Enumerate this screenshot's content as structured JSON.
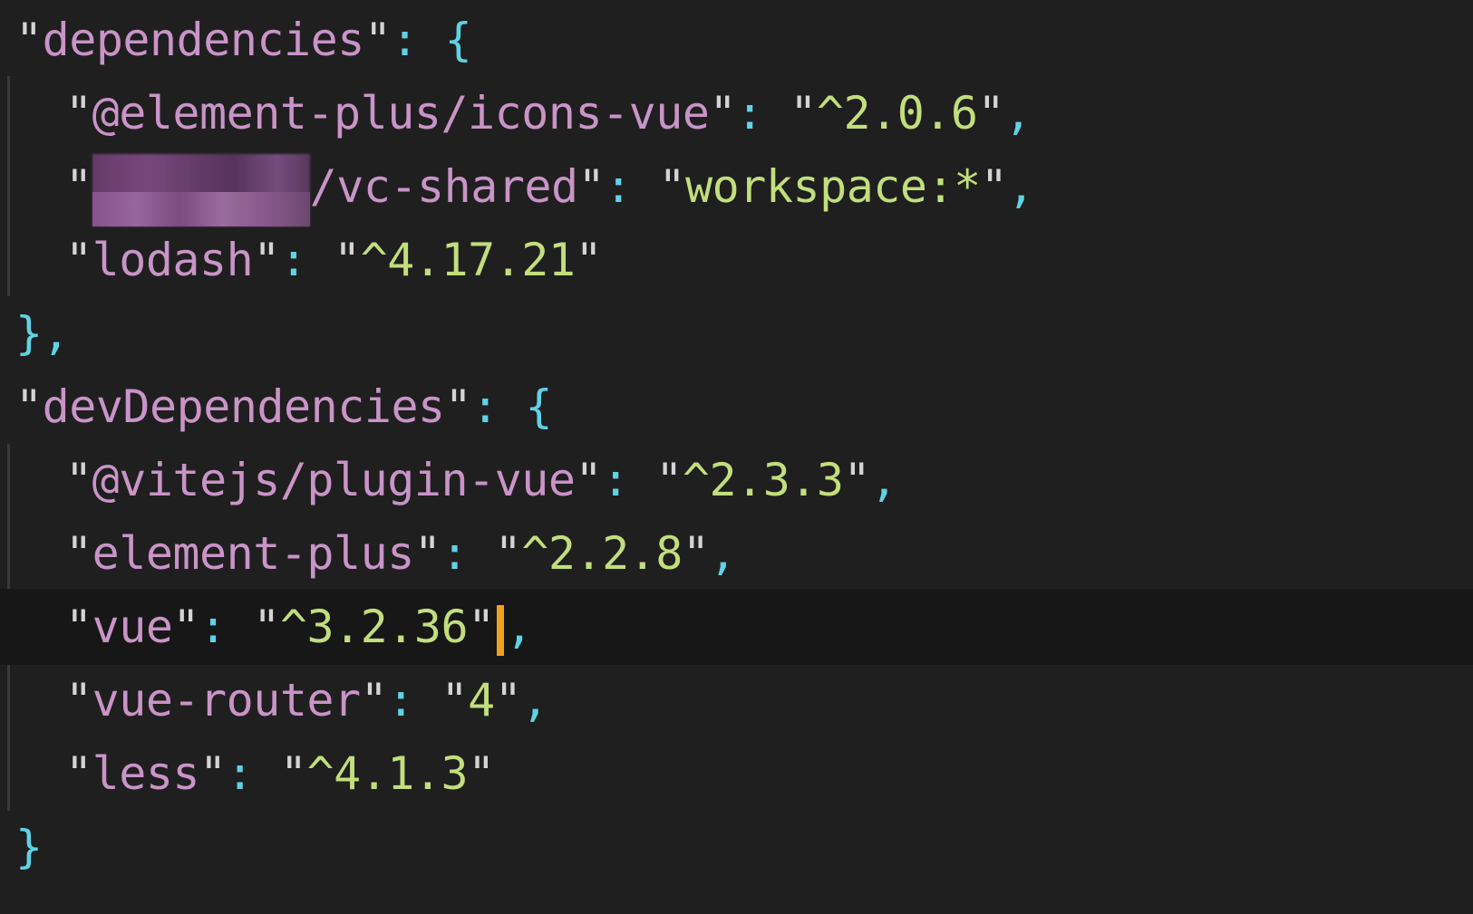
{
  "editor": {
    "lines": [
      {
        "key": "dependencies",
        "open": "{"
      },
      {
        "key": "@element-plus/icons-vue",
        "value": "^2.0.6",
        "trail": ","
      },
      {
        "key_visible_suffix": "/vc-shared",
        "value": "workspace:*",
        "trail": ","
      },
      {
        "key": "lodash",
        "value": "^4.17.21",
        "trail": ""
      },
      {
        "close": "}",
        "trail": ","
      },
      {
        "key": "devDependencies",
        "open": "{"
      },
      {
        "key": "@vitejs/plugin-vue",
        "value": "^2.3.3",
        "trail": ","
      },
      {
        "key": "element-plus",
        "value": "^2.2.8",
        "trail": ","
      },
      {
        "key": "vue",
        "value": "^3.2.36",
        "trail": ","
      },
      {
        "key": "vue-router",
        "value": "4",
        "trail": ","
      },
      {
        "key": "less",
        "value": "^4.1.3",
        "trail": ""
      },
      {
        "close": "}",
        "trail": ""
      }
    ],
    "current_line_index": 8,
    "colors": {
      "background": "#1f1f1f",
      "current_line": "#171717",
      "key": "#c994c7",
      "value": "#c2de7d",
      "punctuation": "#5fd3e6",
      "cursor": "#f0a020"
    }
  }
}
